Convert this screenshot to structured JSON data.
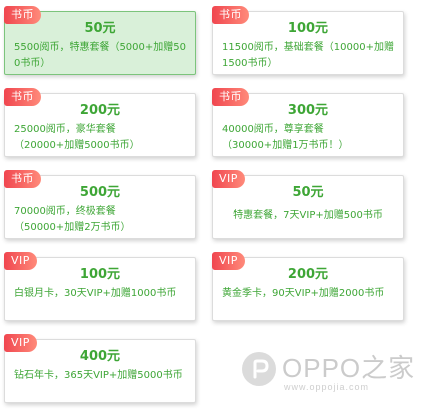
{
  "packages": [
    {
      "badge": "书币",
      "price": "50元",
      "desc": "5500阅币，特惠套餐（5000+加赠500书币）",
      "selected": true
    },
    {
      "badge": "书币",
      "price": "100元",
      "desc": "11500阅币，基础套餐（10000+加赠1500书币）"
    },
    {
      "badge": "书币",
      "price": "200元",
      "desc_lines": [
        "25000阅币，豪华套餐",
        "（20000+加赠5000书币）"
      ]
    },
    {
      "badge": "书币",
      "price": "300元",
      "desc_lines": [
        "40000阅币，尊享套餐",
        "（30000+加赠1万书币！）"
      ]
    },
    {
      "badge": "书币",
      "price": "500元",
      "desc_lines": [
        "70000阅币，终极套餐",
        "（50000+加赠2万书币）"
      ]
    },
    {
      "badge": "VIP",
      "price": "50元",
      "desc": "特惠套餐，7天VIP+加赠500书币"
    },
    {
      "badge": "VIP",
      "price": "100元",
      "desc": "白银月卡，30天VIP+加赠1000书币"
    },
    {
      "badge": "VIP",
      "price": "200元",
      "desc": "黄金季卡，90天VIP+加赠2000书币"
    },
    {
      "badge": "VIP",
      "price": "400元",
      "desc": "钻石年卡，365天VIP+加赠5000书币"
    }
  ],
  "watermark": {
    "brand": "OPPO之家",
    "url": "www.oppojia.com"
  },
  "colors": {
    "accent_green": "#3ea636",
    "selected_bg": "#d9f0d9",
    "badge_red": "#f0464f"
  }
}
